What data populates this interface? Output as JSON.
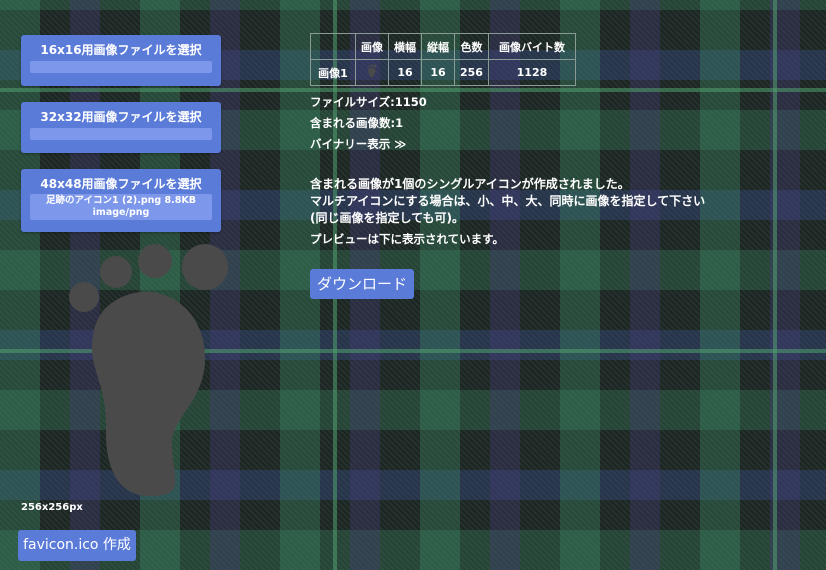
{
  "pickers": [
    {
      "label": "16x16用画像ファイルを選択",
      "file": "",
      "type": ""
    },
    {
      "label": "32x32用画像ファイルを選択",
      "file": "",
      "type": ""
    },
    {
      "label": "48x48用画像ファイルを選択",
      "file": "足跡のアイコン1 (2).png 8.8KB",
      "type": "image/png"
    }
  ],
  "preview": {
    "size_label": "256x256px",
    "icon": "footprint-icon",
    "color": "#4a4a4a"
  },
  "create_button": "favicon.ico 作成",
  "table": {
    "headers": [
      "",
      "画像",
      "横幅",
      "縦幅",
      "色数",
      "画像バイト数"
    ],
    "rows": [
      {
        "name": "画像1",
        "width": "16",
        "height": "16",
        "colors": "256",
        "bytes": "1128"
      }
    ]
  },
  "file_size": "ファイルサイズ:1150",
  "image_count": "含まれる画像数:1",
  "binary_toggle": "バイナリー表示 ≫",
  "message": {
    "line1": "含まれる画像が1個のシングルアイコンが作成されました。",
    "line2": "マルチアイコンにする場合は、小、中、大、同時に画像を指定して下さい",
    "line3": "(同じ画像を指定しても可)。",
    "line4": "プレビューは下に表示されています。"
  },
  "download_button": "ダウンロード",
  "colors": {
    "button": "#5b7bd9",
    "button_inner": "#7d97ea"
  }
}
